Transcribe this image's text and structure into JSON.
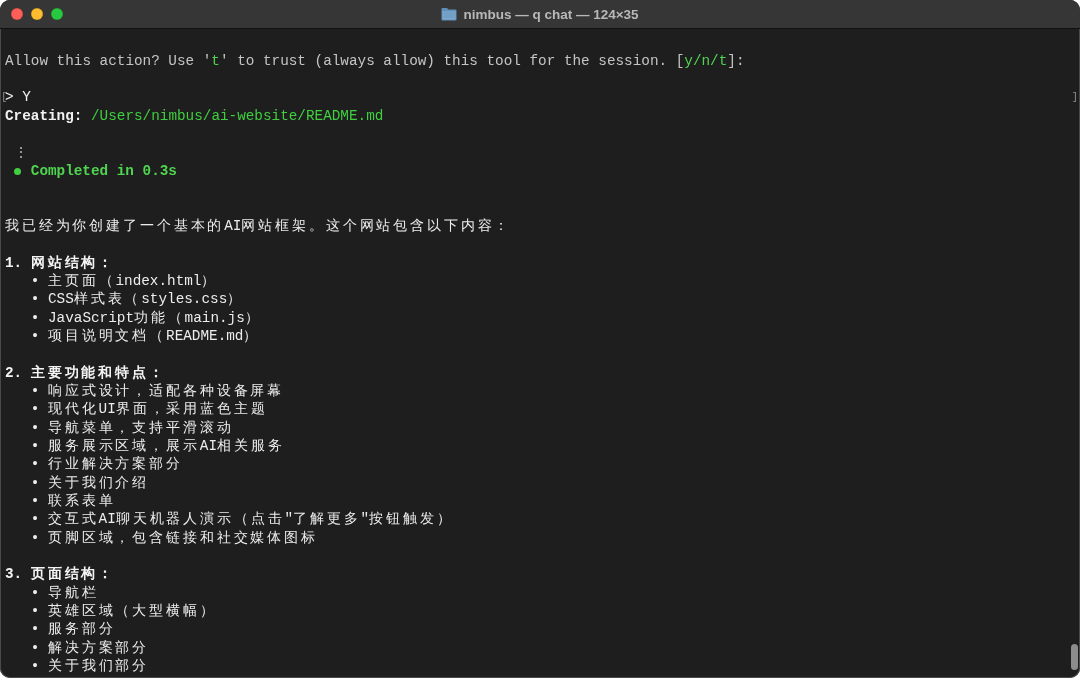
{
  "window": {
    "title": "nimbus — q chat — 124×35"
  },
  "permission_prompt": [
    {
      "text": "Allow this action? Use '",
      "kind": "plain"
    },
    {
      "text": "t",
      "kind": "key"
    },
    {
      "text": "' to trust (always allow) this tool for the session. [",
      "kind": "plain"
    },
    {
      "text": "y/n/t",
      "kind": "key"
    },
    {
      "text": "]:",
      "kind": "plain"
    }
  ],
  "input": {
    "mark_open": "[",
    "value": "> Y",
    "mark_close": "]"
  },
  "creating": {
    "label": "Creating:",
    "path": "/Users/nimbus/ai-website/README.md"
  },
  "progress": "⋮",
  "status": {
    "text": "Completed in 0.3s"
  },
  "summary": "我已经为你创建了一个基本的AI网站框架。这个网站包含以下内容：",
  "sections": [
    {
      "heading": "1. 网站结构：",
      "items": [
        "• 主页面（index.html）",
        "• CSS样式表（styles.css）",
        "• JavaScript功能（main.js）",
        "• 项目说明文档（README.md）"
      ]
    },
    {
      "heading": "2. 主要功能和特点：",
      "items": [
        "• 响应式设计，适配各种设备屏幕",
        "• 现代化UI界面，采用蓝色主题",
        "• 导航菜单，支持平滑滚动",
        "• 服务展示区域，展示AI相关服务",
        "• 行业解决方案部分",
        "• 关于我们介绍",
        "• 联系表单",
        "• 交互式AI聊天机器人演示（点击\"了解更多\"按钮触发）",
        "• 页脚区域，包含链接和社交媒体图标"
      ]
    },
    {
      "heading": "3. 页面结构：",
      "items": [
        "• 导航栏",
        "• 英雄区域（大型横幅）",
        "• 服务部分",
        "• 解决方案部分",
        "• 关于我们部分"
      ]
    }
  ]
}
